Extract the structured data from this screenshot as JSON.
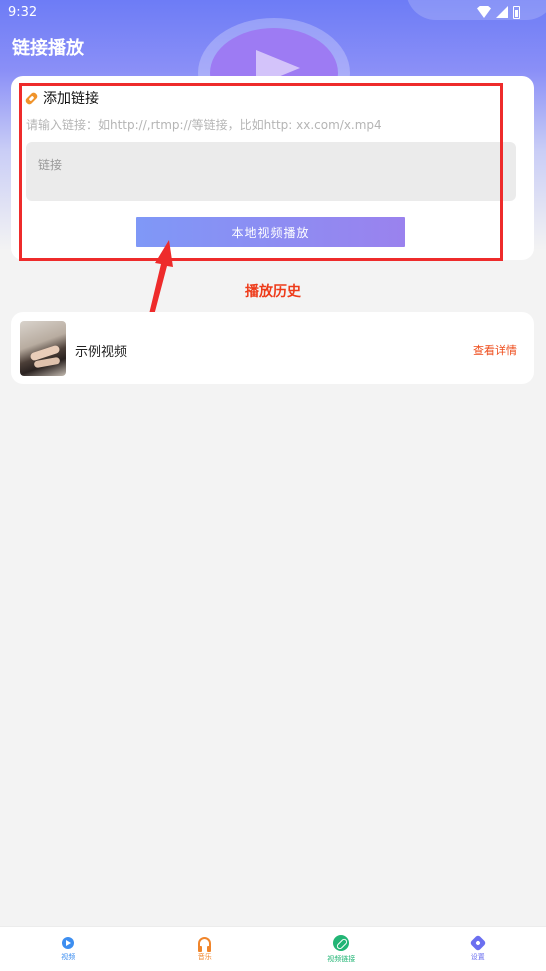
{
  "status_bar": {
    "time": "9:32"
  },
  "header": {
    "title": "链接播放"
  },
  "link_card": {
    "title": "添加链接",
    "hint": "请输入链接：如http://,rtmp://等链接，比如http: xx.com/x.mp4",
    "field_placeholder": "链接",
    "field_value": "",
    "play_button_label": "本地视频播放"
  },
  "history": {
    "title": "播放历史",
    "items": [
      {
        "name": "示例视频",
        "detail_label": "查看详情"
      }
    ]
  },
  "bottom_nav": {
    "items": [
      {
        "label": "视频",
        "icon": "video-icon",
        "color": "#3d8ef0"
      },
      {
        "label": "音乐",
        "icon": "headphones-icon",
        "color": "#f0852b"
      },
      {
        "label": "视频链接",
        "icon": "link-icon",
        "color": "#22b575"
      },
      {
        "label": "设置",
        "icon": "settings-icon",
        "color": "#6b6ff0"
      }
    ]
  },
  "colors": {
    "accent_gradient_start": "#7f98f7",
    "accent_gradient_end": "#9a82ee",
    "history_title": "#ee3b1a",
    "highlight": "#ee2b2b"
  }
}
